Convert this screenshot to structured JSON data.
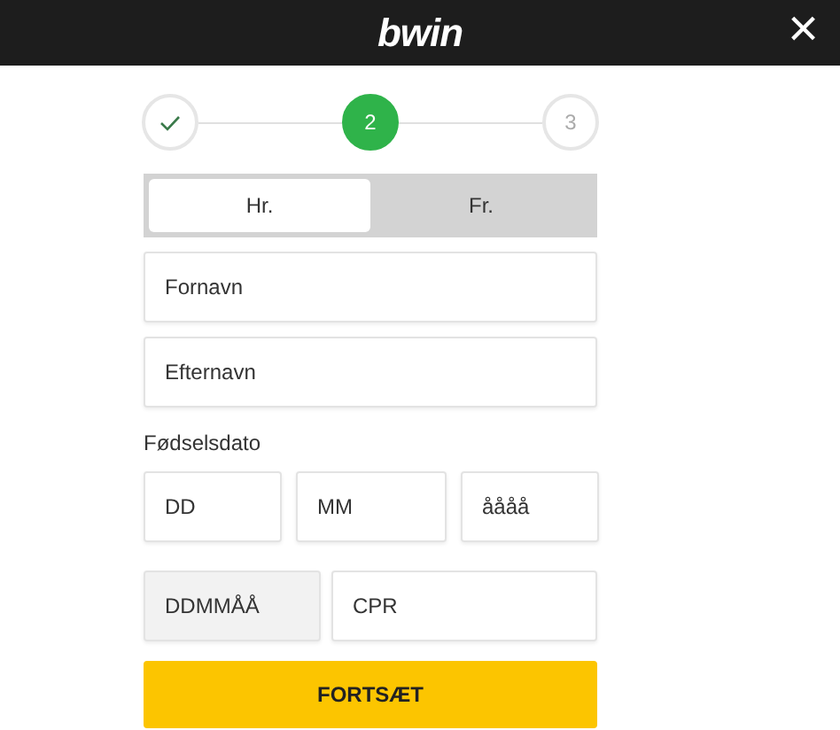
{
  "header": {
    "logo": "bwin",
    "close": "×"
  },
  "steps": [
    {
      "kind": "done"
    },
    {
      "label": "2",
      "kind": "active"
    },
    {
      "label": "3",
      "kind": "pending"
    }
  ],
  "gender": [
    {
      "label": "Hr.",
      "selected": true
    },
    {
      "label": "Fr.",
      "selected": false
    }
  ],
  "fields": [
    {
      "placeholder": "Fornavn"
    },
    {
      "placeholder": "Efternavn"
    }
  ],
  "birthdate": {
    "label": "Fødselsdato",
    "fields": [
      {
        "placeholder": "DD"
      },
      {
        "placeholder": "MM"
      },
      {
        "placeholder": "åååå"
      }
    ]
  },
  "cpr": [
    {
      "placeholder": "DDMMÅÅ",
      "disabled": true
    },
    {
      "placeholder": "CPR",
      "disabled": false
    }
  ],
  "submit": "FORTSÆT"
}
